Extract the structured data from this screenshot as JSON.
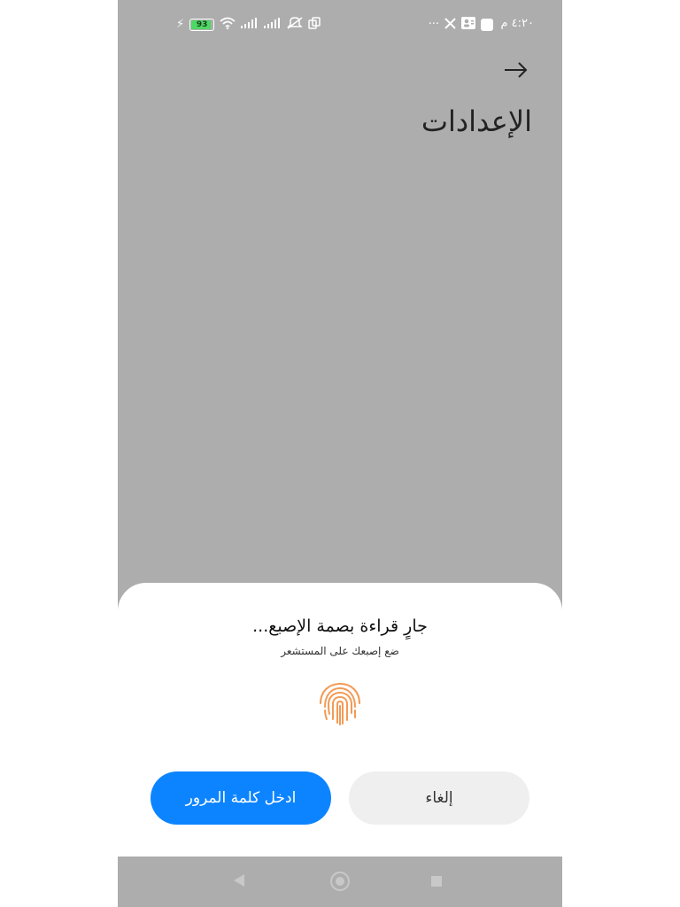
{
  "status_bar": {
    "time": "٤:٢٠ م",
    "battery_level": "93",
    "more": "···",
    "icons": [
      "x-icon",
      "contact-card-icon",
      "notification-square-icon",
      "wifi-icon",
      "signal-icon",
      "signal-icon",
      "mute-icon",
      "screen-icon",
      "charging-icon"
    ]
  },
  "header": {
    "back_icon": "arrow-right-icon",
    "title": "الإعدادات"
  },
  "dialog": {
    "title": "جارٍ قراءة بصمة الإصبع...",
    "subtitle": "ضع إصبعك على المستشعر",
    "fingerprint_icon": "fingerprint-icon",
    "fingerprint_color": "#f39a55",
    "enter_password_label": "ادخل كلمة المرور",
    "cancel_label": "إلغاء",
    "primary_color": "#0d84ff"
  },
  "nav_bar": {
    "icons": [
      "back-icon",
      "home-icon",
      "recents-icon"
    ]
  }
}
